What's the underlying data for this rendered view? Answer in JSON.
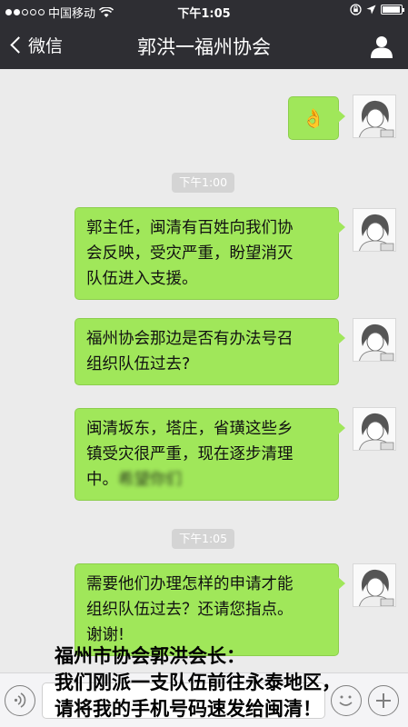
{
  "status_bar": {
    "carrier": "中国移动",
    "time": "下午1:05",
    "battery_icon": "battery-icon",
    "wifi_icon": "wifi-icon",
    "lock_icon": "orientation-lock-icon",
    "location_icon": "location-icon"
  },
  "nav": {
    "back_label": "微信",
    "title": "郭洪一福州协会",
    "profile_icon": "person-icon"
  },
  "colors": {
    "bar_background": "#2e2e33",
    "chat_background": "#ebebeb",
    "bubble_green": "#a0e75a",
    "time_badge": "#d4d4d4"
  },
  "messages": [
    {
      "type": "emoji",
      "emoji": "👌"
    },
    {
      "type": "time",
      "text": "下午1:00"
    },
    {
      "type": "text",
      "lines": [
        "郭主任，闽清有百姓向我们协",
        "会反映，受灾严重，盼望消灭",
        "队伍进入支援。"
      ]
    },
    {
      "type": "text",
      "lines": [
        "福州协会那边是否有办法号召",
        "组织队伍过去?"
      ]
    },
    {
      "type": "text",
      "lines": [
        "闽清坂东，塔庄，省璜这些乡",
        "镇受灾很严重，现在逐步清理",
        "中。"
      ],
      "blurred_tail": "希望你们"
    },
    {
      "type": "time",
      "text": "下午1:05"
    },
    {
      "type": "text",
      "lines": [
        "需要他们办理怎样的申请才能",
        "组织队伍过去？还请您指点。",
        "谢谢!"
      ]
    }
  ],
  "caption": {
    "lines": [
      "福州市协会郭洪会长：",
      "我们刚派一支队伍前往永泰地区，",
      "请将我的手机号码速发给闽清！"
    ]
  },
  "input_bar": {
    "voice_icon": "voice-icon",
    "emoji_icon": "emoji-icon",
    "plus_icon": "plus-icon"
  }
}
